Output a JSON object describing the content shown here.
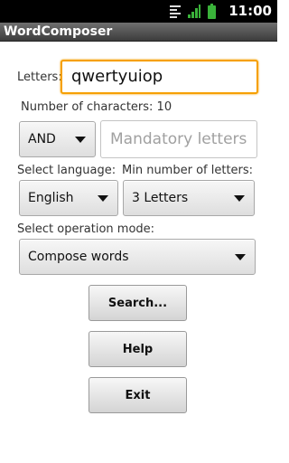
{
  "status_bar": {
    "time": "11:00",
    "icons": [
      "sim-card-icon",
      "signal-icon",
      "battery-icon"
    ],
    "accent_color": "#3ab23a"
  },
  "app": {
    "title": "WordComposer"
  },
  "letters": {
    "label": "Letters:",
    "value": "qwertyuiop",
    "focus_color": "#f6a000"
  },
  "char_count": {
    "text": "Number of characters: 10"
  },
  "logic_select": {
    "selected": "AND"
  },
  "mandatory": {
    "placeholder": "Mandatory letters",
    "value": ""
  },
  "language": {
    "label": "Select language:",
    "selected": "English"
  },
  "min_letters": {
    "label": "Min number of letters:",
    "selected": "3 Letters"
  },
  "mode": {
    "label": "Select operation mode:",
    "selected": "Compose words"
  },
  "buttons": {
    "search": "Search...",
    "help": "Help",
    "exit": "Exit"
  }
}
